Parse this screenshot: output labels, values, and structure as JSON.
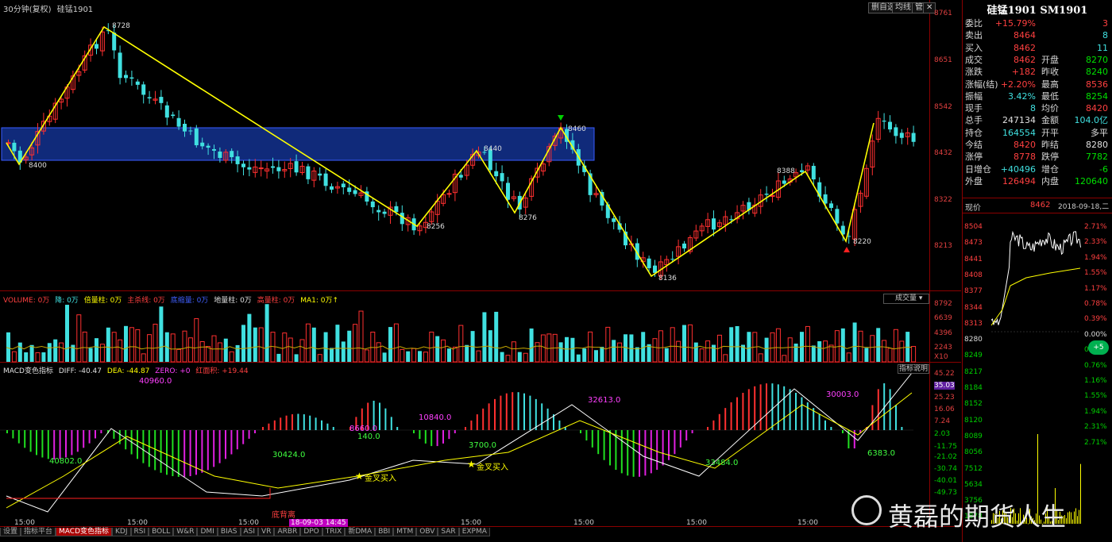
{
  "header": {
    "period": "30分钟(复权)",
    "instrument": "硅锰1901"
  },
  "toolbar": {
    "btn1": "删自选",
    "btn2": "均线",
    "btn3": "管"
  },
  "price_axis": [
    "8761",
    "8651",
    "8542",
    "8432",
    "8322",
    "8213"
  ],
  "price_labels": {
    "p8728": "8728",
    "p8400": "8400",
    "p8256": "8256",
    "p8440": "8440",
    "p8276": "8276",
    "p8460": "8460",
    "p8136": "8136",
    "p8388": "8388",
    "p8220": "8220"
  },
  "volume_legend": {
    "volume": "VOLUME: 0万",
    "down": "降: 0万",
    "ratio": "倍量柱: 0万",
    "main": "主杀线: 0万",
    "low": "底缩量: 0万",
    "ground": "地量柱: 0万",
    "high": "高量柱: 0万",
    "ma1": "MA1: 0万↑",
    "deal": "成交量"
  },
  "volume_axis": [
    "8792",
    "6639",
    "4396",
    "2243",
    "X10"
  ],
  "macd_legend": {
    "name": "MACD变色指标",
    "diff": "DIFF: -40.47",
    "dea": "DEA: -44.87",
    "zero": "ZERO: +0",
    "red": "红面积: +19.44",
    "explain": "指标说明"
  },
  "macd_axis": [
    "45.22",
    "35.03",
    "25.23",
    "16.06",
    "7.24",
    "2.03",
    "-11.75",
    "-21.02",
    "-30.74",
    "-40.01",
    "-49.73"
  ],
  "macd_labels": {
    "a": "40960.0",
    "b": "40802.0",
    "c": "30424.0",
    "d": "8660.0",
    "e": "140.0",
    "f": "10840.0",
    "g": "3700.0",
    "h": "32613.0",
    "i": "33484.0",
    "j": "30003.0",
    "k": "6383.0"
  },
  "cross_labels": {
    "c1": "金叉买入",
    "c2": "金叉买入",
    "diverge": "底背离",
    "date": "18-09-03 14:45"
  },
  "time_labels": [
    "15:00",
    "15:00",
    "15:00",
    "15:00",
    "15:00",
    "15:00",
    "15:00"
  ],
  "tabs": [
    "设置",
    "指标平台",
    "MACD变色指标",
    "KDJ",
    "RSI",
    "BOLL",
    "W&R",
    "DMI",
    "BIAS",
    "ASI",
    "VR",
    "ARBR",
    "DPO",
    "TRIX",
    "新DMA",
    "BBI",
    "MTM",
    "OBV",
    "SAR",
    "EXPMA"
  ],
  "quote": {
    "title": "硅锰1901 SM1901",
    "rows": [
      {
        "l": "委比",
        "v": "+15.79%",
        "r": "3",
        "rl": "",
        "vc": "red",
        "rc": "red"
      },
      {
        "l": "卖出",
        "v": "8464",
        "rl": "",
        "r": "8",
        "vc": "red",
        "rc": "cyan"
      },
      {
        "l": "买入",
        "v": "8462",
        "rl": "",
        "r": "11",
        "vc": "red",
        "rc": "cyan"
      },
      {
        "l": "成交",
        "v": "8462",
        "rl": "开盘",
        "r": "8270",
        "vc": "red",
        "rc": "green"
      },
      {
        "l": "涨跌",
        "v": "+182",
        "rl": "昨收",
        "r": "8240",
        "vc": "red",
        "rc": "green"
      },
      {
        "l": "涨幅(结)",
        "v": "+2.20%",
        "rl": "最高",
        "r": "8536",
        "vc": "red",
        "rc": "red"
      },
      {
        "l": "振幅",
        "v": "3.42%",
        "rl": "最低",
        "r": "8254",
        "vc": "cyan",
        "rc": "green"
      },
      {
        "l": "现手",
        "v": "8",
        "rl": "均价",
        "r": "8420",
        "vc": "cyan",
        "rc": "red"
      },
      {
        "l": "总手",
        "v": "247134",
        "rl": "金额",
        "r": "104.0亿",
        "vc": "white",
        "rc": "cyan"
      },
      {
        "l": "持仓",
        "v": "164554",
        "rl": "开平",
        "r": "多平",
        "vc": "cyan",
        "rc": "white"
      },
      {
        "l": "今结",
        "v": "8420",
        "rl": "昨结",
        "r": "8280",
        "vc": "red",
        "rc": "white"
      },
      {
        "l": "涨停",
        "v": "8778",
        "rl": "跌停",
        "r": "7782",
        "vc": "red",
        "rc": "green"
      },
      {
        "l": "日增仓",
        "v": "+40496",
        "rl": "增仓",
        "r": "-6",
        "vc": "cyan",
        "rc": "green"
      },
      {
        "l": "外盘",
        "v": "126494",
        "rl": "内盘",
        "r": "120640",
        "vc": "red",
        "rc": "green"
      }
    ],
    "mini_header": {
      "label": "现价",
      "price": "8462",
      "date": "2018-09-18,二"
    },
    "mini_left": [
      "8504",
      "8473",
      "8441",
      "8408",
      "8377",
      "8344",
      "8313",
      "8280",
      "8249",
      "8217",
      "8184",
      "8152",
      "8120",
      "8089",
      "8056",
      "7512",
      "5634",
      "3756",
      "1878"
    ],
    "mini_right": [
      "2.71%",
      "2.33%",
      "1.94%",
      "1.55%",
      "1.17%",
      "0.78%",
      "0.39%",
      "0.00%",
      "0.38%",
      "0.76%",
      "1.16%",
      "1.55%",
      "1.94%",
      "2.31%",
      "2.71%"
    ],
    "mini_badge": "+5"
  },
  "watermark": "黄磊的期货人生",
  "colors": {
    "up": "#ff3030",
    "down": "#40e0e0",
    "zigzag": "#ffff00",
    "zone": "#102a7a",
    "ma": "#ffff00"
  }
}
